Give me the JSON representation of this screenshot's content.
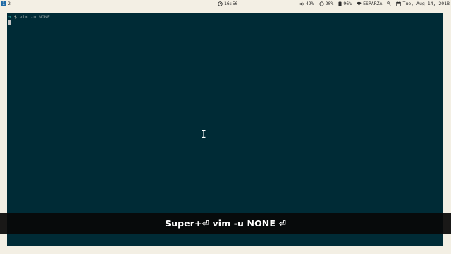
{
  "topbar": {
    "workspaces": [
      {
        "label": "1",
        "active": true
      },
      {
        "label": "2",
        "active": false
      }
    ],
    "clock": {
      "icon": "clock-icon",
      "time": "16:56"
    },
    "status": {
      "volume": {
        "icon": "speaker-icon",
        "value": "49%"
      },
      "cpu": {
        "icon": "circle-icon",
        "value": "20%"
      },
      "battery": {
        "icon": "battery-icon",
        "value": "96%"
      },
      "wifi": {
        "icon": "wifi-icon",
        "value": "ESPARZA"
      },
      "vpn": {
        "icon": "key-icon"
      },
      "date": {
        "icon": "calendar-icon",
        "value": "Tue, Aug 14, 2018"
      }
    },
    "colors": {
      "bar_bg": "#f3efe4",
      "active_ws_bg": "#1f6aa5"
    }
  },
  "terminal": {
    "prompt_symbol": "➜",
    "prompt_dollar": "$",
    "command": "vim -u NONE",
    "colors": {
      "bg": "#002b36",
      "text": "#93a1a1",
      "cursor": "#c4c4c4"
    }
  },
  "key_overlay": {
    "text": "Super+⏎ vim -u NONE ⏎"
  }
}
